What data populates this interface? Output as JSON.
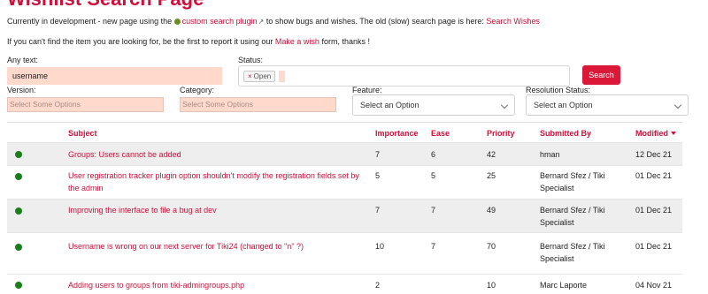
{
  "page": {
    "title": "Wishlist Search Page",
    "intro_prefix": "Currently in development - new page using the",
    "intro_link": "custom search plugin",
    "intro_middle": "to show bugs and wishes. The old (slow) search page is here:",
    "intro_old_link": "Search Wishes",
    "report_prefix": "If you can't find the item you are looking for, be the first to report it using our",
    "report_link": "Make a wish",
    "report_suffix": "form, thanks !"
  },
  "filters": {
    "any_text_label": "Any text:",
    "any_text_value": "username",
    "status_label": "Status:",
    "status_chip": "Open",
    "search_button": "Search",
    "version_label": "Version:",
    "version_placeholder": "Select Some Options",
    "category_label": "Category:",
    "category_placeholder": "Select Some Options",
    "feature_label": "Feature:",
    "feature_value": "Select an Option",
    "resolution_label": "Resolution Status:",
    "resolution_value": "Select an Option"
  },
  "table": {
    "headers": [
      "Subject",
      "Importance",
      "Ease",
      "Priority",
      "Submitted By",
      "Modified"
    ],
    "rows": [
      {
        "subject": "Groups: Users cannot be added",
        "importance": "7",
        "ease": "6",
        "priority": "42",
        "submitted_by": "hman",
        "modified": "12 Dec 21"
      },
      {
        "subject": "User registration tracker plugin option shouldn't modify the registration fields set by the admin",
        "importance": "5",
        "ease": "5",
        "priority": "25",
        "submitted_by": "Bernard Sfez / Tiki Specialist",
        "modified": "01 Dec 21"
      },
      {
        "subject": "Improving the interface to file a bug at dev",
        "importance": "7",
        "ease": "7",
        "priority": "49",
        "submitted_by": "Bernard Sfez / Tiki Specialist",
        "modified": "01 Dec 21"
      },
      {
        "subject": "Username is wrong on our next server for Tiki24 (changed to \"n\" ?)",
        "importance": "10",
        "ease": "7",
        "priority": "70",
        "submitted_by": "Bernard Sfez / Tiki Specialist",
        "modified": "01 Dec 21"
      },
      {
        "subject": "Adding users to groups from tiki-admingroups.php",
        "importance": "2",
        "ease": "",
        "priority": "10",
        "submitted_by": "Marc Laporte",
        "modified": "04 Nov 21"
      }
    ]
  },
  "colors": {
    "accent": "#d0103a",
    "status_open": "#1c7d1c",
    "highlight_field": "#ffd9cc"
  },
  "icons": {
    "status_dot": "status-open-dot-icon",
    "external_link": "external-link-icon",
    "sort": "sort-descending-icon"
  }
}
